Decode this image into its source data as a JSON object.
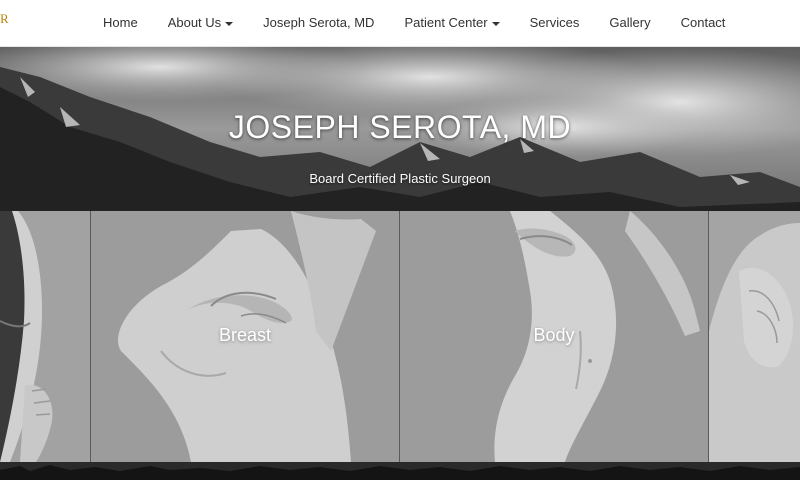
{
  "logo": {
    "text": "R"
  },
  "nav": {
    "items": [
      {
        "label": "Home",
        "dropdown": false
      },
      {
        "label": "About Us",
        "dropdown": true
      },
      {
        "label": "Joseph Serota, MD",
        "dropdown": false
      },
      {
        "label": "Patient Center",
        "dropdown": true
      },
      {
        "label": "Services",
        "dropdown": false
      },
      {
        "label": "Gallery",
        "dropdown": false
      },
      {
        "label": "Contact",
        "dropdown": false
      }
    ]
  },
  "hero": {
    "title": "JOSEPH SEROTA, MD",
    "subtitle": "Board Certified Plastic Surgeon"
  },
  "gallery": {
    "tiles": [
      {
        "label": ""
      },
      {
        "label": "Breast"
      },
      {
        "label": "Body"
      },
      {
        "label": ""
      }
    ]
  },
  "colors": {
    "nav_text": "#333333",
    "accent": "#b8860b",
    "hero_text": "#ffffff"
  }
}
